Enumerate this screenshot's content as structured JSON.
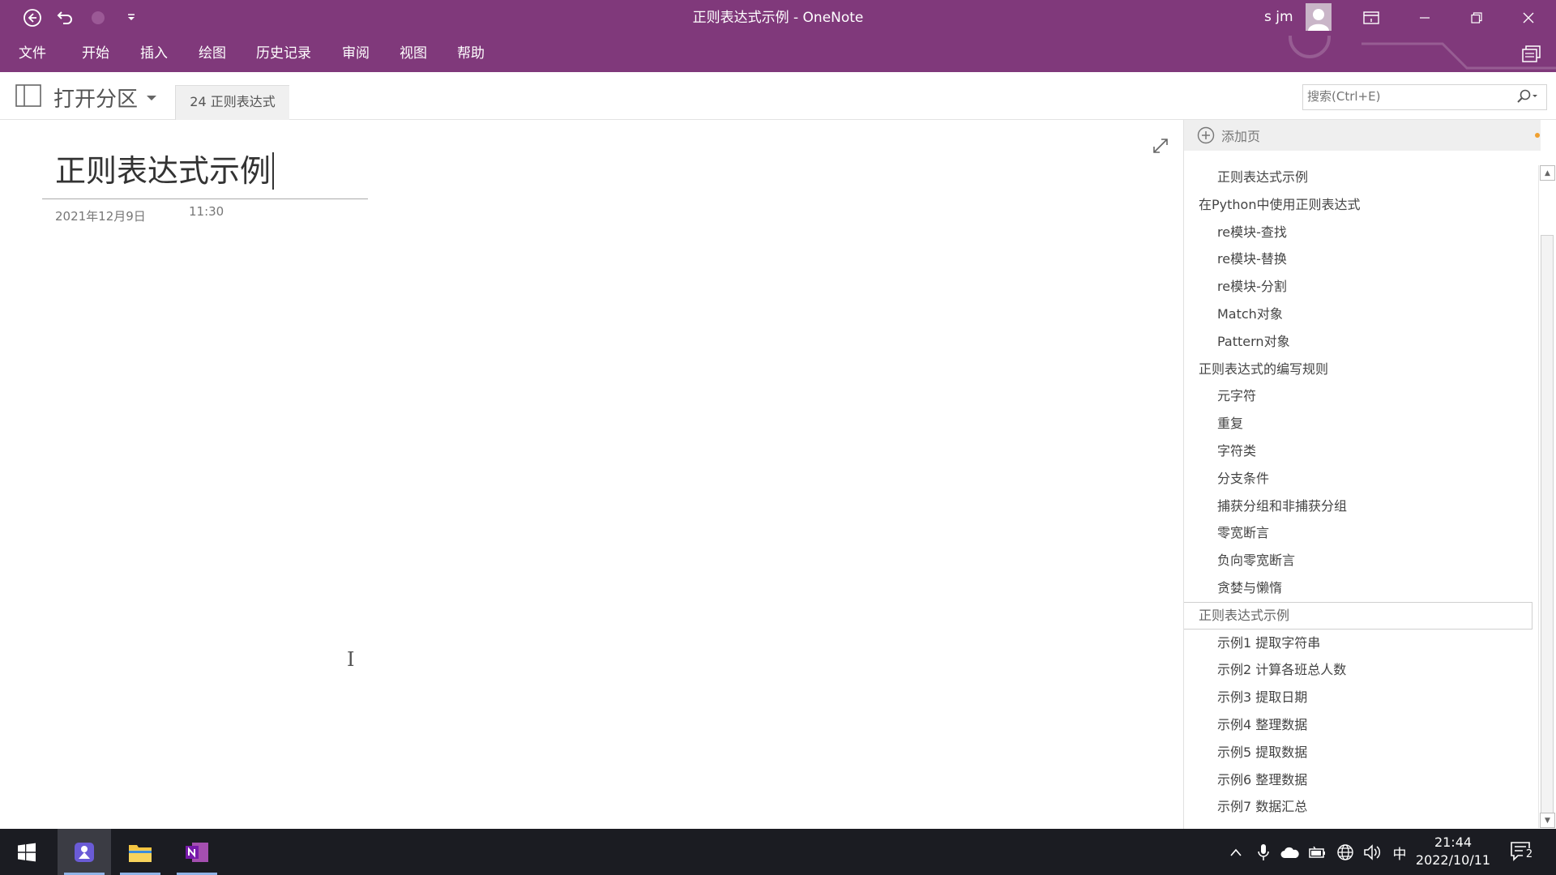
{
  "window": {
    "title": "正则表达式示例  -  OneNote",
    "user_name": "s jm"
  },
  "ribbon": {
    "tabs": [
      "文件",
      "开始",
      "插入",
      "绘图",
      "历史记录",
      "审阅",
      "视图",
      "帮助"
    ]
  },
  "notebook": {
    "label": "打开分区",
    "section_tab": "24 正则表达式"
  },
  "search": {
    "placeholder": "搜索(Ctrl+E)"
  },
  "page": {
    "title": "正则表达式示例",
    "date": "2021年12月9日",
    "time": "11:30"
  },
  "pages_pane": {
    "add_page_label": "添加页",
    "items": [
      {
        "label": "正则表达式示例",
        "level": 2
      },
      {
        "label": "在Python中使用正则表达式",
        "level": 1
      },
      {
        "label": "re模块-查找",
        "level": 2
      },
      {
        "label": "re模块-替换",
        "level": 2
      },
      {
        "label": "re模块-分割",
        "level": 2
      },
      {
        "label": "Match对象",
        "level": 2
      },
      {
        "label": "Pattern对象",
        "level": 2
      },
      {
        "label": "正则表达式的编写规则",
        "level": 1
      },
      {
        "label": "元字符",
        "level": 2
      },
      {
        "label": "重复",
        "level": 2
      },
      {
        "label": "字符类",
        "level": 2
      },
      {
        "label": "分支条件",
        "level": 2
      },
      {
        "label": "捕获分组和非捕获分组",
        "level": 2
      },
      {
        "label": "零宽断言",
        "level": 2
      },
      {
        "label": "负向零宽断言",
        "level": 2
      },
      {
        "label": "贪婪与懒惰",
        "level": 2
      },
      {
        "label": "正则表达式示例",
        "level": 1,
        "selected": true
      },
      {
        "label": "示例1 提取字符串",
        "level": 2
      },
      {
        "label": "示例2 计算各班总人数",
        "level": 2
      },
      {
        "label": "示例3 提取日期",
        "level": 2
      },
      {
        "label": "示例4 整理数据",
        "level": 2
      },
      {
        "label": "示例5 提取数据",
        "level": 2
      },
      {
        "label": "示例6 整理数据",
        "level": 2
      },
      {
        "label": "示例7 数据汇总",
        "level": 2
      }
    ]
  },
  "taskbar": {
    "tray_ime": "中",
    "time": "21:44",
    "date": "2022/10/11",
    "notification_count": "2"
  },
  "colors": {
    "accent": "#80397b",
    "taskbar": "#1b1c22"
  },
  "icons": [
    "back-icon",
    "undo-icon",
    "redo-icon",
    "customize-qat-icon",
    "ribbon-display-icon",
    "minimize-icon",
    "restore-icon",
    "close-icon",
    "notebook-icon",
    "dropdown-icon",
    "search-icon",
    "expand-icon",
    "add-page-icon",
    "windows-start-icon",
    "file-explorer-icon",
    "onenote-app-icon",
    "mic-icon",
    "onedrive-icon",
    "network-icon",
    "volume-icon",
    "notification-icon"
  ]
}
